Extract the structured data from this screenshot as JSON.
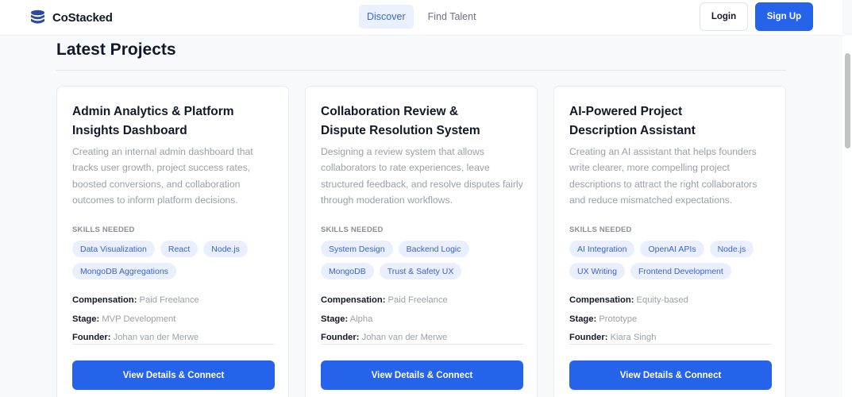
{
  "navbar": {
    "brand": "CoStacked",
    "brand_icon": "database-stack-icon",
    "tabs": [
      {
        "label": "Discover",
        "active": true
      },
      {
        "label": "Find Talent",
        "active": false
      }
    ],
    "login_label": "Login",
    "signup_label": "Sign Up"
  },
  "section": {
    "title": "Latest Projects"
  },
  "colors": {
    "accent": "#2563eb",
    "pill_bg": "#e9effc",
    "pill_text": "#3b63c9",
    "muted_text": "#9aa0aa"
  },
  "projects": [
    {
      "title_line1": "Admin Analytics & Platform",
      "title_line2": "Insights Dashboard",
      "description": "Creating an internal admin dashboard that tracks user growth, project success rates, boosted conversions, and collaboration outcomes to inform platform decisions.",
      "skills_label": "SKILLS NEEDED",
      "skills": [
        "Data Visualization",
        "React",
        "Node.js",
        "MongoDB Aggregations"
      ],
      "compensation_label": "Compensation:",
      "compensation": "Paid Freelance",
      "stage_label": "Stage:",
      "stage": "MVP Development",
      "founder_label": "Founder:",
      "founder": "Johan van der Merwe",
      "cta_label": "View Details & Connect"
    },
    {
      "title_line1": "Collaboration Review &",
      "title_line2": "Dispute Resolution System",
      "description": "Designing a review system that allows collaborators to rate experiences, leave structured feedback, and resolve disputes fairly through moderation workflows.",
      "skills_label": "SKILLS NEEDED",
      "skills": [
        "System Design",
        "Backend Logic",
        "MongoDB",
        "Trust & Safety UX"
      ],
      "compensation_label": "Compensation:",
      "compensation": "Paid Freelance",
      "stage_label": "Stage:",
      "stage": "Alpha",
      "founder_label": "Founder:",
      "founder": "Johan van der Merwe",
      "cta_label": "View Details & Connect"
    },
    {
      "title_line1": "AI-Powered Project",
      "title_line2": "Description Assistant",
      "description": "Creating an AI assistant that helps founders write clearer, more compelling project descriptions to attract the right collaborators and reduce mismatched expectations.",
      "skills_label": "SKILLS NEEDED",
      "skills": [
        "AI Integration",
        "OpenAI APIs",
        "Node.js",
        "UX Writing",
        "Frontend Development"
      ],
      "compensation_label": "Compensation:",
      "compensation": "Equity-based",
      "stage_label": "Stage:",
      "stage": "Prototype",
      "founder_label": "Founder:",
      "founder": "Kiara Singh",
      "cta_label": "View Details & Connect"
    }
  ]
}
